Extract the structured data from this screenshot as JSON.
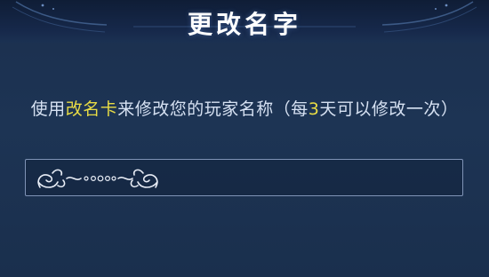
{
  "dialog": {
    "title": "更改名字",
    "info": {
      "prefix": "使用",
      "card_name": "改名卡",
      "middle": "来修改您的玩家名称（每",
      "days": "3",
      "suffix": "天可以修改一次）"
    },
    "name_input": {
      "value": "",
      "decoration_icon": "ornamental-flourish-icon"
    }
  },
  "colors": {
    "background": "#1d3454",
    "highlight": "#e8dc45",
    "text": "#d6e1f2",
    "input_border": "#7f93b6"
  }
}
